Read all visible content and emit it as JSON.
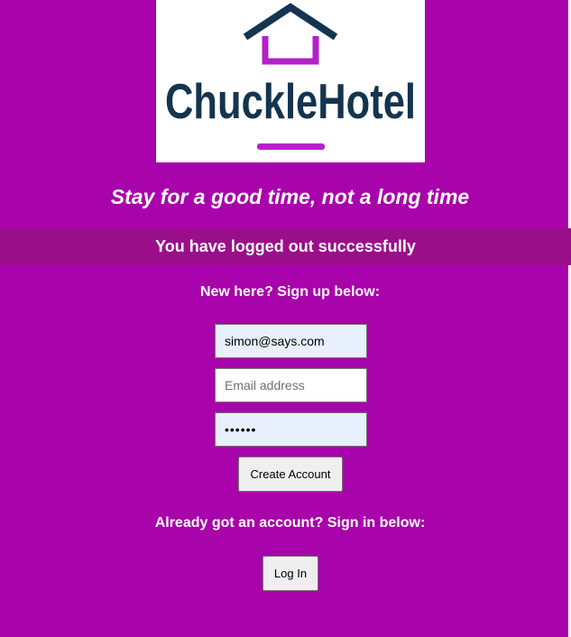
{
  "brand": {
    "name": "ChuckleHotel",
    "tagline": "Stay for a good time, not a long time",
    "colors": {
      "background": "#a903ab",
      "banner": "#9b0e8a",
      "logo_text": "#14344f",
      "logo_accent": "#b321c8"
    }
  },
  "status": {
    "message": "You have logged out successfully"
  },
  "signup": {
    "heading": "New here? Sign up below:",
    "email_value": "simon@says.com",
    "second_email_placeholder": "Email address",
    "password_value": "••••••",
    "submit_label": "Create Account"
  },
  "signin": {
    "heading": "Already got an account? Sign in below:",
    "login_label": "Log In"
  }
}
